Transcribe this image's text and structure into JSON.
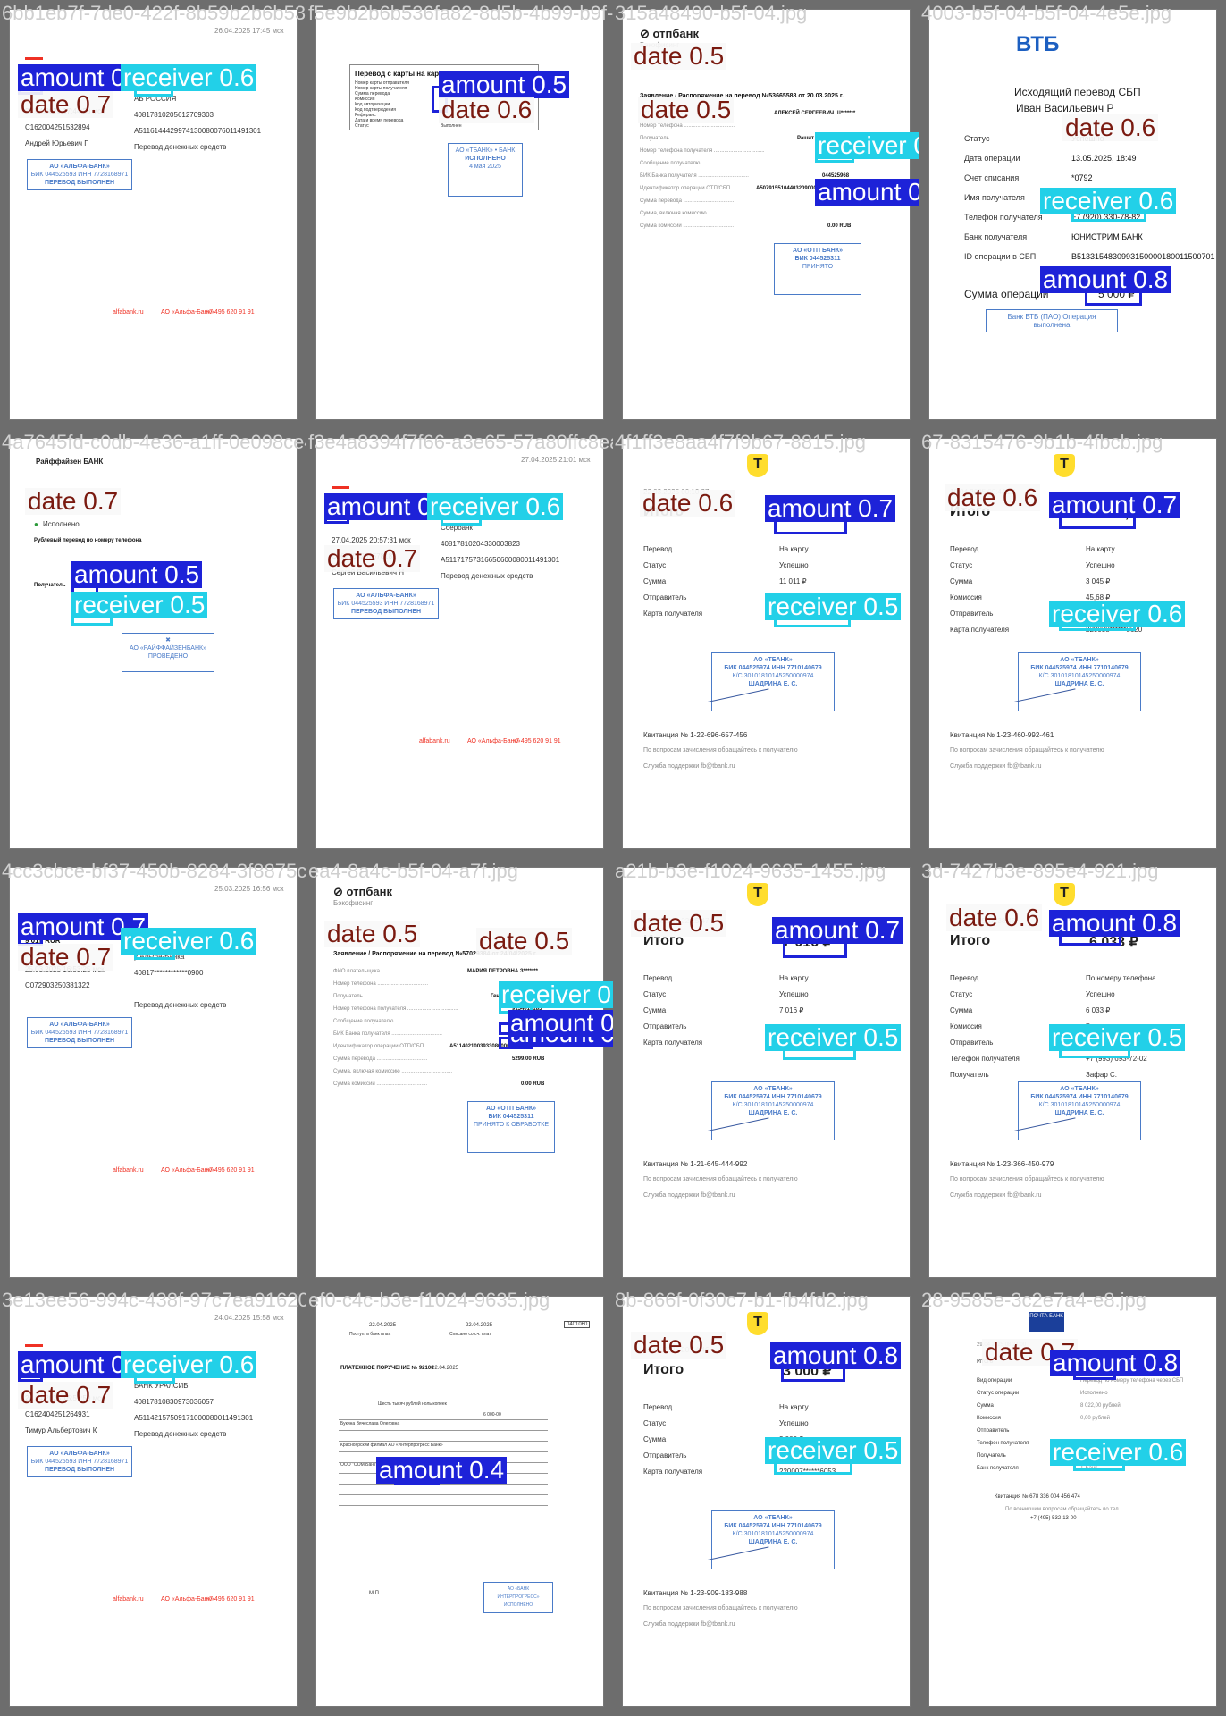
{
  "tiles": [
    {
      "filename": "6bb1eb7f-7de0-422f-8b59b2b6b536fa82.jpg",
      "template": "alfa",
      "texts": {
        "ts": "26.04.2025 17:44:23 мск",
        "op": "C162004251532894",
        "sum": "9 020 RUR",
        "bank": "АО «Альфа-Банк»",
        "acc": "40817810205612709303",
        "sbp": "A5116144429974130080076011491301",
        "who": "Андрей Юрьевич Г",
        "type": "Перевод денежных средств",
        "date": "26.04.2025 17:45 мск",
        "bank2": "АБ РОССИЯ",
        "phone": "79700359677"
      },
      "labels": [
        {
          "kind": "amount",
          "text": "amount 0."
        },
        {
          "kind": "receiver",
          "text": "receiver 0.6"
        },
        {
          "kind": "date",
          "text": "date 0.7"
        }
      ]
    },
    {
      "filename": "f5e9b2b6b536fa82-8d5b-4b99-b9f-04.jpg",
      "template": "card2card",
      "texts": {
        "title": "Перевод с карты на карту",
        "status": "Выполнен",
        "stamp_title": "ИСПОЛНЕНО",
        "stamp_date": "4 мая 2025"
      },
      "labels": [
        {
          "kind": "amount",
          "text": "amount 0.5"
        },
        {
          "kind": "date",
          "text": "date 0.6"
        }
      ]
    },
    {
      "filename": "315a48490-b5f-04.jpg",
      "template": "otp",
      "texts": {
        "title": "Заявление / Распоряжение на перевод №53665588 от 20.03.2025 г.",
        "payer": "АЛЕКСЕЙ СЕРГЕЕВИЧ Ш*******",
        "recv": "Рашит Газ",
        "phone": "9306647996",
        "bank": "044525968",
        "sbp": "A50791551044032090000",
        "sum": "6040.00 RUB",
        "fee": "0.00 RUB",
        "stamp1": "АО «ОТП БАНК»",
        "stamp2": "БИК 044525311",
        "stamp3": "ПРИНЯТО"
      },
      "labels": [
        {
          "kind": "date",
          "text": "date 0.5"
        },
        {
          "kind": "date",
          "text": "date 0.5"
        },
        {
          "kind": "receiver",
          "text": "receiver 0.6"
        },
        {
          "kind": "amount",
          "text": "amount 0.8"
        }
      ]
    },
    {
      "filename": "4003-b5f-04-b5f-04-4e5e.jpg",
      "template": "vtb",
      "texts": {
        "brand": "ВТБ",
        "title": "Исходящий перевод СБП",
        "payer": "Иван Васильевич Р",
        "status_label": "Статус",
        "status_val": "Успешно",
        "date_label": "Дата операции",
        "date_val": "13.05.2025, 18:49",
        "acc_label": "Счет списания",
        "acc_val": "*0792",
        "recv_label": "Имя получателя",
        "recv_val": "Людмила Карловна Ч.",
        "phone_label": "Телефон получателя",
        "phone_val": "+7 (920) 330-78-82",
        "bank_label": "Банк получателя",
        "bank_val": "ЮНИСТРИМ БАНК",
        "id_label": "ID операции в СБП",
        "id_val": "B5133154830993150000180011500701",
        "sum_label": "Сумма операции",
        "sum_val": "5 000 ₽",
        "stamp": "Банк ВТБ (ПАО) Операция выполнена"
      },
      "labels": [
        {
          "kind": "date",
          "text": "date 0.6"
        },
        {
          "kind": "receiver",
          "text": "receiver 0.6"
        },
        {
          "kind": "amount",
          "text": "amount 0.8"
        }
      ]
    },
    {
      "filename": "4a7645fd-c0db-4e36-a1ff-0e098ce4e33a.jpg",
      "template": "raif",
      "texts": {
        "brand": "Райффайзен БАНК",
        "date": "03.04.2025",
        "status": "Исполнено",
        "title": "Рублевый перевод по номеру телефона",
        "sum": "1 000 RUR",
        "recv": "Получатель",
        "phone": "79164967712",
        "bank": "Сбербанк"
      },
      "labels": [
        {
          "kind": "date",
          "text": "date 0.7"
        },
        {
          "kind": "amount",
          "text": "amount 0.5"
        },
        {
          "kind": "receiver",
          "text": "receiver 0.5"
        }
      ]
    },
    {
      "filename": "f3e4a8394f7f66-a3e65-57a80ffc8ea.jpg",
      "template": "alfa",
      "texts": {
        "ts": "27.04.2025 20:57:31 мск",
        "op": "C162704251578181",
        "sum": "5 000 RUR",
        "bank": "Сбербанк",
        "acc": "40817810204330003823",
        "sbp": "A51171757316650600080011491301",
        "who": "Сергей Васильевич Н",
        "type": "Перевод денежных средств",
        "date": "27.04.2025 21:01 мск",
        "bank2": "Сбербанк",
        "phone": "79217460303"
      },
      "labels": [
        {
          "kind": "amount",
          "text": "amount 0."
        },
        {
          "kind": "receiver",
          "text": "receiver 0.6"
        },
        {
          "kind": "date",
          "text": "date 0.7"
        }
      ]
    },
    {
      "filename": "4f1ff3e8aa4f7f9b67-8815.jpg",
      "template": "tbank",
      "texts": {
        "date": "22.03.2025 00:10:37",
        "total_label": "Итого",
        "total": "11 011 ₽",
        "r1": "Перевод",
        "v1": "На карту",
        "r2": "Статус",
        "v2": "Успешно",
        "r3": "Сумма",
        "v3": "11 011 ₽",
        "r4": "Отправитель",
        "v4": "",
        "r5": "Карта получателя",
        "v5": "220038******1717",
        "stamp1": "АО «ТБАНК»",
        "stamp2": "БИК 044525974 ИНН 7710140679",
        "stamp3": "К/С 30101810145250000974",
        "stamp4": "ШАДРИНА Е. С.",
        "kv": "Квитанция № 1-22-696-657-456",
        "q": "По вопросам зачисления обращайтесь к получателю",
        "sup": "Служба поддержки fb@tbank.ru"
      },
      "labels": [
        {
          "kind": "date",
          "text": "date 0.6"
        },
        {
          "kind": "amount",
          "text": "amount 0.7"
        },
        {
          "kind": "receiver",
          "text": "receiver 0.5"
        }
      ]
    },
    {
      "filename": "67-8315476-9b1b-4fbcb.jpg",
      "template": "tbank",
      "texts": {
        "date": "19.04.2025 00:44:28",
        "total_label": "Итого",
        "total": "3 090,68 ₽",
        "r1": "Перевод",
        "v1": "На карту",
        "r2": "Статус",
        "v2": "Успешно",
        "r3": "Сумма",
        "v3": "3 045 ₽",
        "r4": "Комиссия",
        "v4": "45,68 ₽",
        "r5": "Отправитель",
        "v5": "",
        "r6": "Карта получателя",
        "v6": "220038******8620",
        "stamp1": "АО «ТБАНК»",
        "stamp2": "БИК 044525974 ИНН 7710140679",
        "stamp3": "К/С 30101810145250000974",
        "stamp4": "ШАДРИНА Е. С.",
        "kv": "Квитанция № 1-23-460-992-461",
        "q": "По вопросам зачисления обращайтесь к получателю",
        "sup": "Служба поддержки fb@tbank.ru"
      },
      "labels": [
        {
          "kind": "date",
          "text": "date 0.6"
        },
        {
          "kind": "amount",
          "text": "amount 0.7"
        },
        {
          "kind": "receiver",
          "text": "receiver 0.6"
        }
      ]
    },
    {
      "filename": "4cc3cbce-bf37-450b-8284-3f8875c7b54ba4.jpg",
      "template": "alfa",
      "texts": {
        "ts": "25.03.2025 16:53:25 мск",
        "op": "C072903250381322",
        "sum": "9 019 RUR",
        "bank": "Клиенту Альфа-Банка",
        "acc": "40817************0900",
        "sbp": "",
        "who": "",
        "type": "Перевод денежных средств",
        "date": "25.03.2025 16:56 мск",
        "bank2": "у Альфа-Банка",
        "phone": "938****4565"
      },
      "labels": [
        {
          "kind": "amount",
          "text": "amount 0.7"
        },
        {
          "kind": "receiver",
          "text": "receiver 0.6"
        },
        {
          "kind": "date",
          "text": "date 0.7"
        }
      ]
    },
    {
      "filename": "ea4-8a4c-b5f-04-a7f.jpg",
      "template": "otp",
      "texts": {
        "title": "Заявление / Распоряжение на перевод №57029384 от 24/04/2025 г.",
        "payer": "МАРИЯ ПЕТРОВНА З*******",
        "recv": "Геннади",
        "phone": "9154015185",
        "bank": "",
        "sbp": "A51140210039330800000",
        "sum": "5299.00 RUB",
        "fee": "0.00 RUB",
        "stamp1": "АО «ОТП БАНК»",
        "stamp2": "БИК 044525311",
        "stamp3": "ПРИНЯТО К ОБРАБОТКЕ"
      },
      "labels": [
        {
          "kind": "date",
          "text": "date 0.5"
        },
        {
          "kind": "date",
          "text": "date 0.5"
        },
        {
          "kind": "receiver",
          "text": "receiver 0.6"
        },
        {
          "kind": "amount",
          "text": "amount 0.7"
        },
        {
          "kind": "amount",
          "text": "amount 0.3"
        }
      ]
    },
    {
      "filename": "a21b-b3e-f1024-9635-1455.jpg",
      "template": "tbank",
      "texts": {
        "date": "10.03.2025 22:25:47",
        "total_label": "Итого",
        "total": "7 016 ₽",
        "r1": "Перевод",
        "v1": "На карту",
        "r2": "Статус",
        "v2": "Успешно",
        "r3": "Сумма",
        "v3": "7 016 ₽",
        "r4": "Отправитель",
        "v4": "",
        "r5": "Карта получателя",
        "v5": "220053******6886",
        "stamp1": "АО «ТБАНК»",
        "stamp2": "БИК 044525974 ИНН 7710140679",
        "stamp3": "К/С 30101810145250000974",
        "stamp4": "ШАДРИНА Е. С.",
        "kv": "Квитанция № 1-21-645-444-992",
        "q": "По вопросам зачисления обращайтесь к получателю",
        "sup": "Служба поддержки fb@tbank.ru"
      },
      "labels": [
        {
          "kind": "date",
          "text": "date 0.5"
        },
        {
          "kind": "amount",
          "text": "amount 0.7"
        },
        {
          "kind": "receiver",
          "text": "receiver 0.5"
        }
      ]
    },
    {
      "filename": "3d-7427b3e-895e4-921.jpg",
      "template": "tbank",
      "texts": {
        "date": "15.04.2025 18:38:48",
        "total_label": "Итого",
        "total": "6 033 ₽",
        "r1": "Перевод",
        "v1": "По номеру телефона",
        "r2": "Статус",
        "v2": "Успешно",
        "r3": "Сумма",
        "v3": "6 033 ₽",
        "r4": "Комиссия",
        "v4": "Без комиссии",
        "r5": "Отправитель",
        "v5": "",
        "r6": "Телефон получателя",
        "v6": "+7 (993) 693-72-02",
        "r7": "Получатель",
        "v7": "Зафар С.",
        "stamp1": "АО «ТБАНК»",
        "stamp2": "БИК 044525974 ИНН 7710140679",
        "stamp3": "К/С 30101810145250000974",
        "stamp4": "ШАДРИНА Е. С.",
        "kv": "Квитанция № 1-23-366-450-979",
        "q": "По вопросам зачисления обращайтесь к получателю",
        "sup": "Служба поддержки fb@tbank.ru"
      },
      "labels": [
        {
          "kind": "date",
          "text": "date 0.6"
        },
        {
          "kind": "amount",
          "text": "amount 0.8"
        },
        {
          "kind": "receiver",
          "text": "receiver 0.5"
        }
      ]
    },
    {
      "filename": "3e13ee56-994c-438f-97c7ea916204c5261.jpg",
      "template": "alfa",
      "texts": {
        "ts": "24.04.2025 15:57:50 мск",
        "op": "C162404251264931",
        "sum": "5 000 RUR",
        "bank": "БАНК УРАЛСИБ",
        "acc": "40817810830973036057",
        "sbp": "A51142157509171000080011491301",
        "who": "Тимур Альбертович К",
        "type": "Перевод денежных средств",
        "date": "24.04.2025 15:58 мск",
        "bank2": "БАНК УРАЛСИБ",
        "phone": "79901947990"
      },
      "labels": [
        {
          "kind": "amount",
          "text": "amount 0."
        },
        {
          "kind": "receiver",
          "text": "receiver 0.6"
        },
        {
          "kind": "date",
          "text": "date 0.7"
        }
      ]
    },
    {
      "filename": "ef0-c4c-b3e-f1024-9635.jpg",
      "template": "platezhka",
      "texts": {
        "d1": "22.04.2025",
        "d2": "22.04.2025",
        "code": "0401060",
        "title": "ПЛАТЕЖНОЕ ПОРУЧЕНИЕ № 92100",
        "date": "22.04.2025",
        "sumwords": "Шесть тысяч рублей ноль копеек",
        "sum": "6 000-00",
        "payer": "Букина Вячеслава Олеговна",
        "bank": "Красноярский филиал АО «Интерпрогресс Банк»",
        "recv": "ООО \"ООМ Банк\"",
        "stamp": "АО «БАНК ИНТЕРПРОГРЕСС» ИСПОЛНЕНО",
        "mp": "М.П."
      },
      "labels": [
        {
          "kind": "amount",
          "text": "amount 0.4"
        }
      ]
    },
    {
      "filename": "8b-866f-0f30c7-b1-fb4fd2.jpg",
      "template": "tbank",
      "texts": {
        "date": "05.05.2025 20:14:46",
        "total_label": "Итого",
        "total": "3 000 ₽",
        "r1": "Перевод",
        "v1": "На карту",
        "r2": "Статус",
        "v2": "Успешно",
        "r3": "Сумма",
        "v3": "3 000 ₽",
        "r4": "Отправитель",
        "v4": "",
        "r5": "Карта получателя",
        "v5": "220007******6053",
        "stamp1": "АО «ТБАНК»",
        "stamp2": "БИК 044525974 ИНН 7710140679",
        "stamp3": "К/С 30101810145250000974",
        "stamp4": "ШАДРИНА Е. С.",
        "kv": "Квитанция № 1-23-909-183-988",
        "q": "По вопросам зачисления обращайтесь к получателю",
        "sup": "Служба поддержки fb@tbank.ru"
      },
      "labels": [
        {
          "kind": "date",
          "text": "date 0.5"
        },
        {
          "kind": "amount",
          "text": "amount 0.8"
        },
        {
          "kind": "receiver",
          "text": "receiver 0.5"
        }
      ]
    },
    {
      "filename": "28-9585e-3c2e7a4-e8.jpg",
      "template": "pochta",
      "texts": {
        "brand": "ПОЧТА БАНК",
        "date": "29.04.2025 08:24:00",
        "total_label": "Итого",
        "total": "8 022,00 рублей",
        "r1": "Вид операции",
        "v1": "Перевод по номеру телефона через СБП",
        "r2": "Статус операции",
        "v2": "Исполнено",
        "r3": "Сумма",
        "v3": "8 022,00 рублей",
        "r4": "Комиссия",
        "v4": "0,00 рублей",
        "r5": "Отправитель",
        "v5": "",
        "r6": "Телефон получателя",
        "v6": "+7 (928) 872-22-18",
        "r7": "Получатель",
        "v7": "Алисхон Закинович Х",
        "r8": "Банк получателя",
        "v8": "Т-Банк",
        "kv": "Квитанция № 678 336 004 456 474",
        "q": "По возникшим вопросам обращайтесь по тел.",
        "tel": "+7 (495) 532-13-00"
      },
      "labels": [
        {
          "kind": "date",
          "text": "date 0.7"
        },
        {
          "kind": "amount",
          "text": "amount 0.8"
        },
        {
          "kind": "receiver",
          "text": "receiver 0.6"
        }
      ]
    }
  ]
}
